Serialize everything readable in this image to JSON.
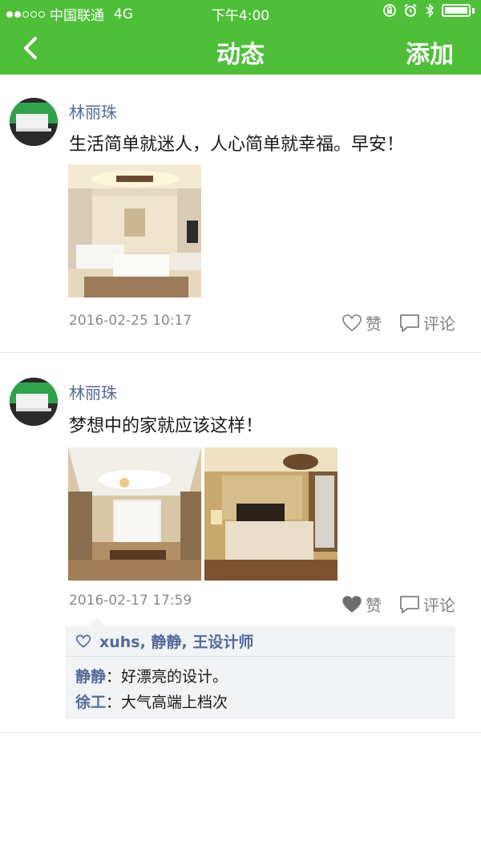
{
  "status_bar": {
    "carrier": "中国联通",
    "network": "4G",
    "time": "下午4:00"
  },
  "nav": {
    "back_icon": "chevron-left-icon",
    "title": "动态",
    "action": "添加"
  },
  "colors": {
    "brand_green": "#4fbf3a",
    "name_blue": "#546a9a",
    "muted_gray": "#8a8a8a"
  },
  "posts": [
    {
      "author": "林丽珠",
      "text": "生活简单就迷人，人心简单就幸福。早安！",
      "time": "2016-02-25 10:17",
      "like_label": "赞",
      "like_state": "outline",
      "comment_label": "评论",
      "likes": [],
      "comments": []
    },
    {
      "author": "林丽珠",
      "text": "梦想中的家就应该这样！",
      "time": "2016-02-17 17:59",
      "like_label": "赞",
      "like_state": "filled",
      "comment_label": "评论",
      "likes": [
        "xuhs",
        "静静",
        "王设计师"
      ],
      "comments": [
        {
          "name": "静静",
          "text": "好漂亮的设计。"
        },
        {
          "name": "徐工",
          "text": "大气高端上档次"
        }
      ]
    }
  ]
}
